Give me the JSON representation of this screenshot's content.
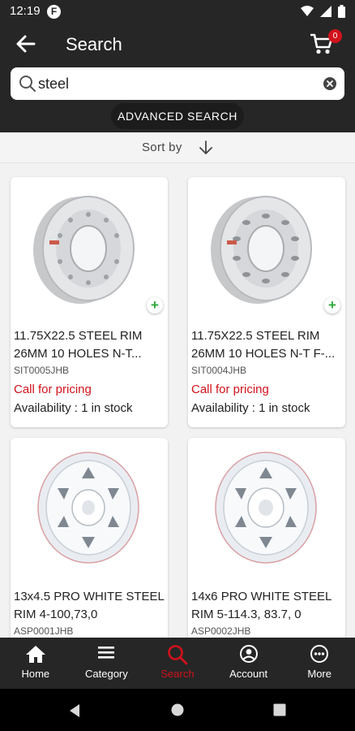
{
  "status_bar": {
    "time": "12:19",
    "app_icon": "F"
  },
  "header": {
    "title": "Search",
    "cart_count": "0"
  },
  "search": {
    "value": "steel",
    "advanced_label": "ADVANCED SEARCH"
  },
  "sort": {
    "label": "Sort by"
  },
  "products": [
    {
      "title": "11.75X22.5 STEEL RIM 26MM 10 HOLES N-T...",
      "sku": "SIT0005JHB",
      "price": "Call for pricing",
      "availability": "Availability : 1 in stock",
      "image": "silver-rim"
    },
    {
      "title": "11.75X22.5 STEEL RIM 26MM 10 HOLES N-T F-...",
      "sku": "SIT0004JHB",
      "price": "Call for pricing",
      "availability": "Availability : 1 in stock",
      "image": "silver-rim"
    },
    {
      "title": "13x4.5 PRO WHITE STEEL RIM 4-100,73,0",
      "sku": "ASP0001JHB",
      "image": "white-rim"
    },
    {
      "title": "14x6 PRO WHITE STEEL RIM 5-114.3, 83.7, 0",
      "sku": "ASP0002JHB",
      "image": "white-rim"
    }
  ],
  "bottom_nav": [
    {
      "label": "Home",
      "icon": "home-icon"
    },
    {
      "label": "Category",
      "icon": "menu-icon"
    },
    {
      "label": "Search",
      "icon": "search-icon",
      "active": true
    },
    {
      "label": "Account",
      "icon": "account-icon"
    },
    {
      "label": "More",
      "icon": "more-icon"
    }
  ],
  "colors": {
    "accent": "#d0121b",
    "header_bg": "#262626",
    "add_green": "#2faa3a"
  }
}
